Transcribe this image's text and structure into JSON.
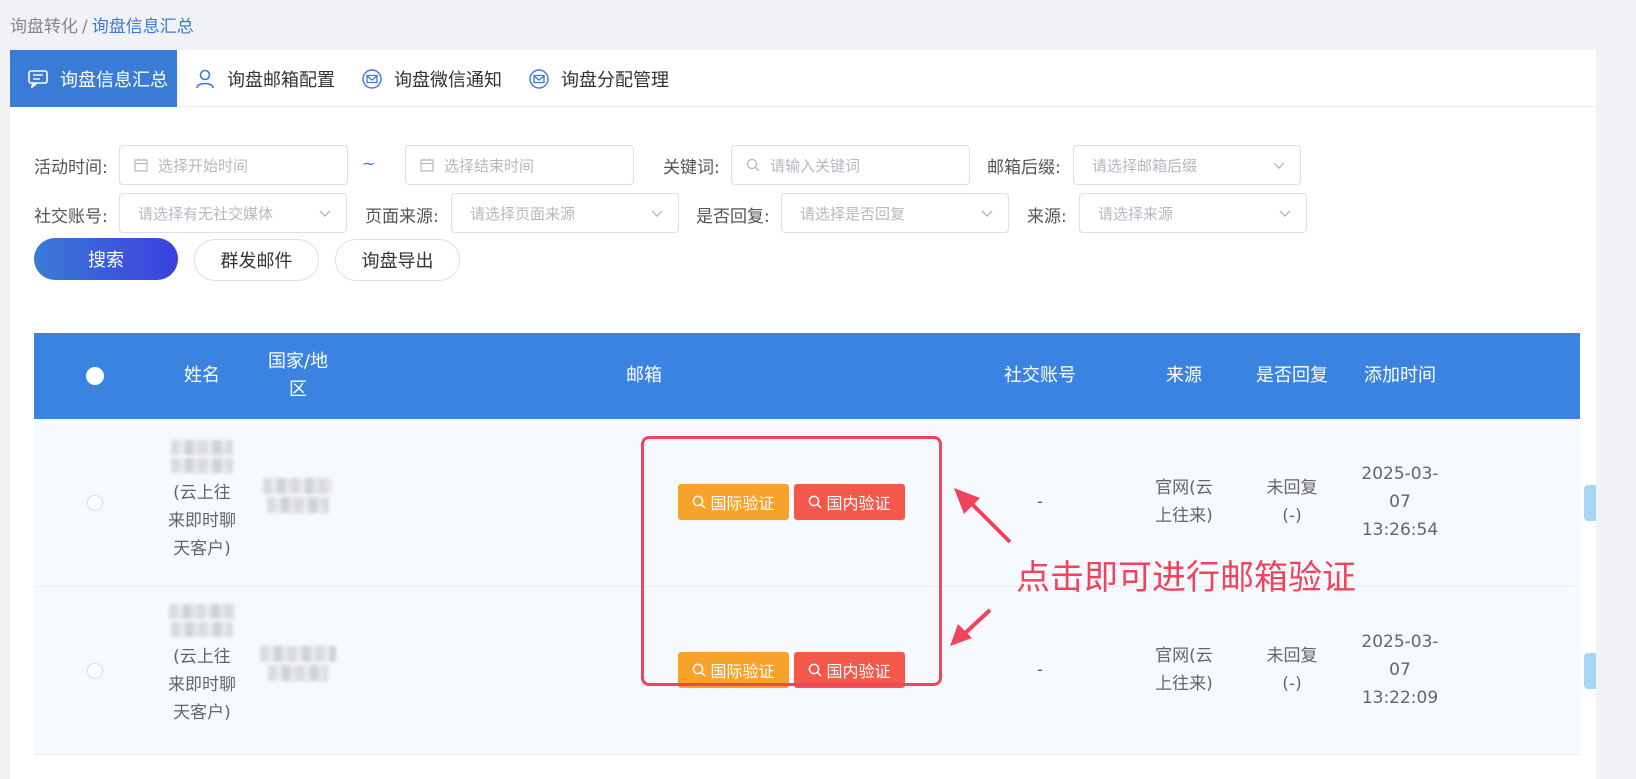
{
  "breadcrumb": {
    "parent": "询盘转化",
    "separator": "/",
    "current": "询盘信息汇总"
  },
  "tabs": [
    {
      "label": "询盘信息汇总",
      "icon": "chat-icon",
      "active": true
    },
    {
      "label": "询盘邮箱配置",
      "icon": "user-icon",
      "active": false
    },
    {
      "label": "询盘微信通知",
      "icon": "mail-icon",
      "active": false
    },
    {
      "label": "询盘分配管理",
      "icon": "mail-icon",
      "active": false
    }
  ],
  "filters": {
    "activity_time": {
      "label": "活动时间:",
      "start_placeholder": "选择开始时间",
      "separator": "~",
      "end_placeholder": "选择结束时间"
    },
    "keyword": {
      "label": "关键词:",
      "placeholder": "请输入关键词"
    },
    "email_suffix": {
      "label": "邮箱后缀:",
      "placeholder": "请选择邮箱后缀"
    },
    "social_account": {
      "label": "社交账号:",
      "placeholder": "请选择有无社交媒体"
    },
    "page_source": {
      "label": "页面来源:",
      "placeholder": "请选择页面来源"
    },
    "replied": {
      "label": "是否回复:",
      "placeholder": "请选择是否回复"
    },
    "source": {
      "label": "来源:",
      "placeholder": "请选择来源"
    }
  },
  "actions": {
    "search": "搜索",
    "bulk_mail": "群发邮件",
    "export": "询盘导出"
  },
  "table": {
    "headers": {
      "name": "姓名",
      "country": "国家/地区",
      "email": "邮箱",
      "social": "社交账号",
      "source": "来源",
      "replied": "是否回复",
      "added": "添加时间"
    },
    "rows": [
      {
        "name_suffix": "(云上往来即时聊天客户)",
        "social": "-",
        "source": "官网(云上往来)",
        "replied": "未回复(-)",
        "added": "2025-03-07 13:26:54",
        "intl_verify": "国际验证",
        "dom_verify": "国内验证"
      },
      {
        "name_suffix": "(云上往来即时聊天客户)",
        "social": "-",
        "source": "官网(云上往来)",
        "replied": "未回复(-)",
        "added": "2025-03-07 13:22:09",
        "intl_verify": "国际验证",
        "dom_verify": "国内验证"
      }
    ]
  },
  "annotation": {
    "text": "点击即可进行邮箱验证",
    "color": "#f2435c"
  },
  "colors": {
    "primary": "#3a7bd5",
    "header_bg": "#3b83e0",
    "intl_button": "#f7a22b",
    "dom_button": "#f4584a"
  }
}
